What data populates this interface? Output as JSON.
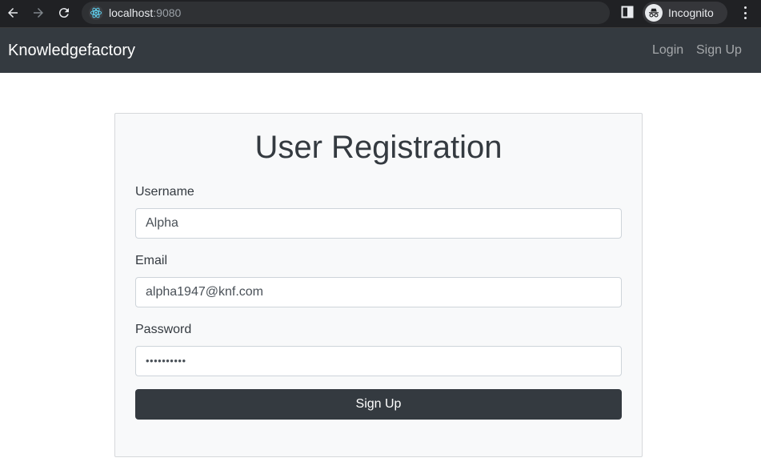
{
  "browser": {
    "url_host": "localhost",
    "url_port": ":9080",
    "incognito_label": "Incognito",
    "icons": {
      "back": "arrow-left-icon",
      "forward": "arrow-right-icon",
      "reload": "reload-icon",
      "site": "react-logo-icon",
      "side_panel": "side-panel-icon",
      "incognito": "incognito-icon",
      "menu": "kebab-menu-icon"
    }
  },
  "navbar": {
    "brand": "Knowledgefactory",
    "links": {
      "login": "Login",
      "signup": "Sign Up"
    },
    "bg_color": "#343a40"
  },
  "form": {
    "title": "User Registration",
    "username": {
      "label": "Username",
      "value": "Alpha"
    },
    "email": {
      "label": "Email",
      "value": "alpha1947@knf.com"
    },
    "password": {
      "label": "Password",
      "value": "••••••••••"
    },
    "submit_label": "Sign Up"
  }
}
